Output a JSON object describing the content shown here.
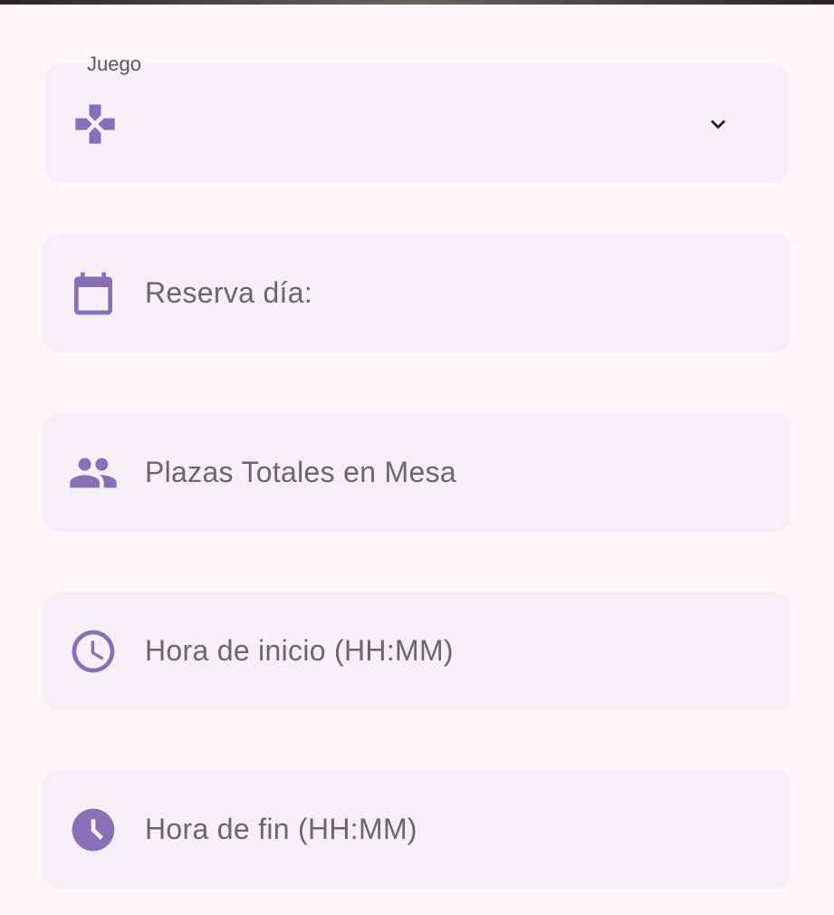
{
  "form": {
    "game": {
      "label": "Juego",
      "value": "",
      "icon": "gamepad-icon"
    },
    "date": {
      "placeholder": "Reserva día:",
      "icon": "calendar-icon"
    },
    "seats": {
      "placeholder": "Plazas Totales en Mesa",
      "icon": "people-icon"
    },
    "start_time": {
      "placeholder": "Hora de inicio (HH:MM)",
      "icon": "clock-outline-icon"
    },
    "end_time": {
      "placeholder": "Hora de fin (HH:MM)",
      "icon": "clock-filled-icon"
    }
  },
  "colors": {
    "accent": "#8a6fb8",
    "field_bg": "#f5eff6",
    "page_bg": "#fdf7fc",
    "text_muted": "#6c6472"
  }
}
